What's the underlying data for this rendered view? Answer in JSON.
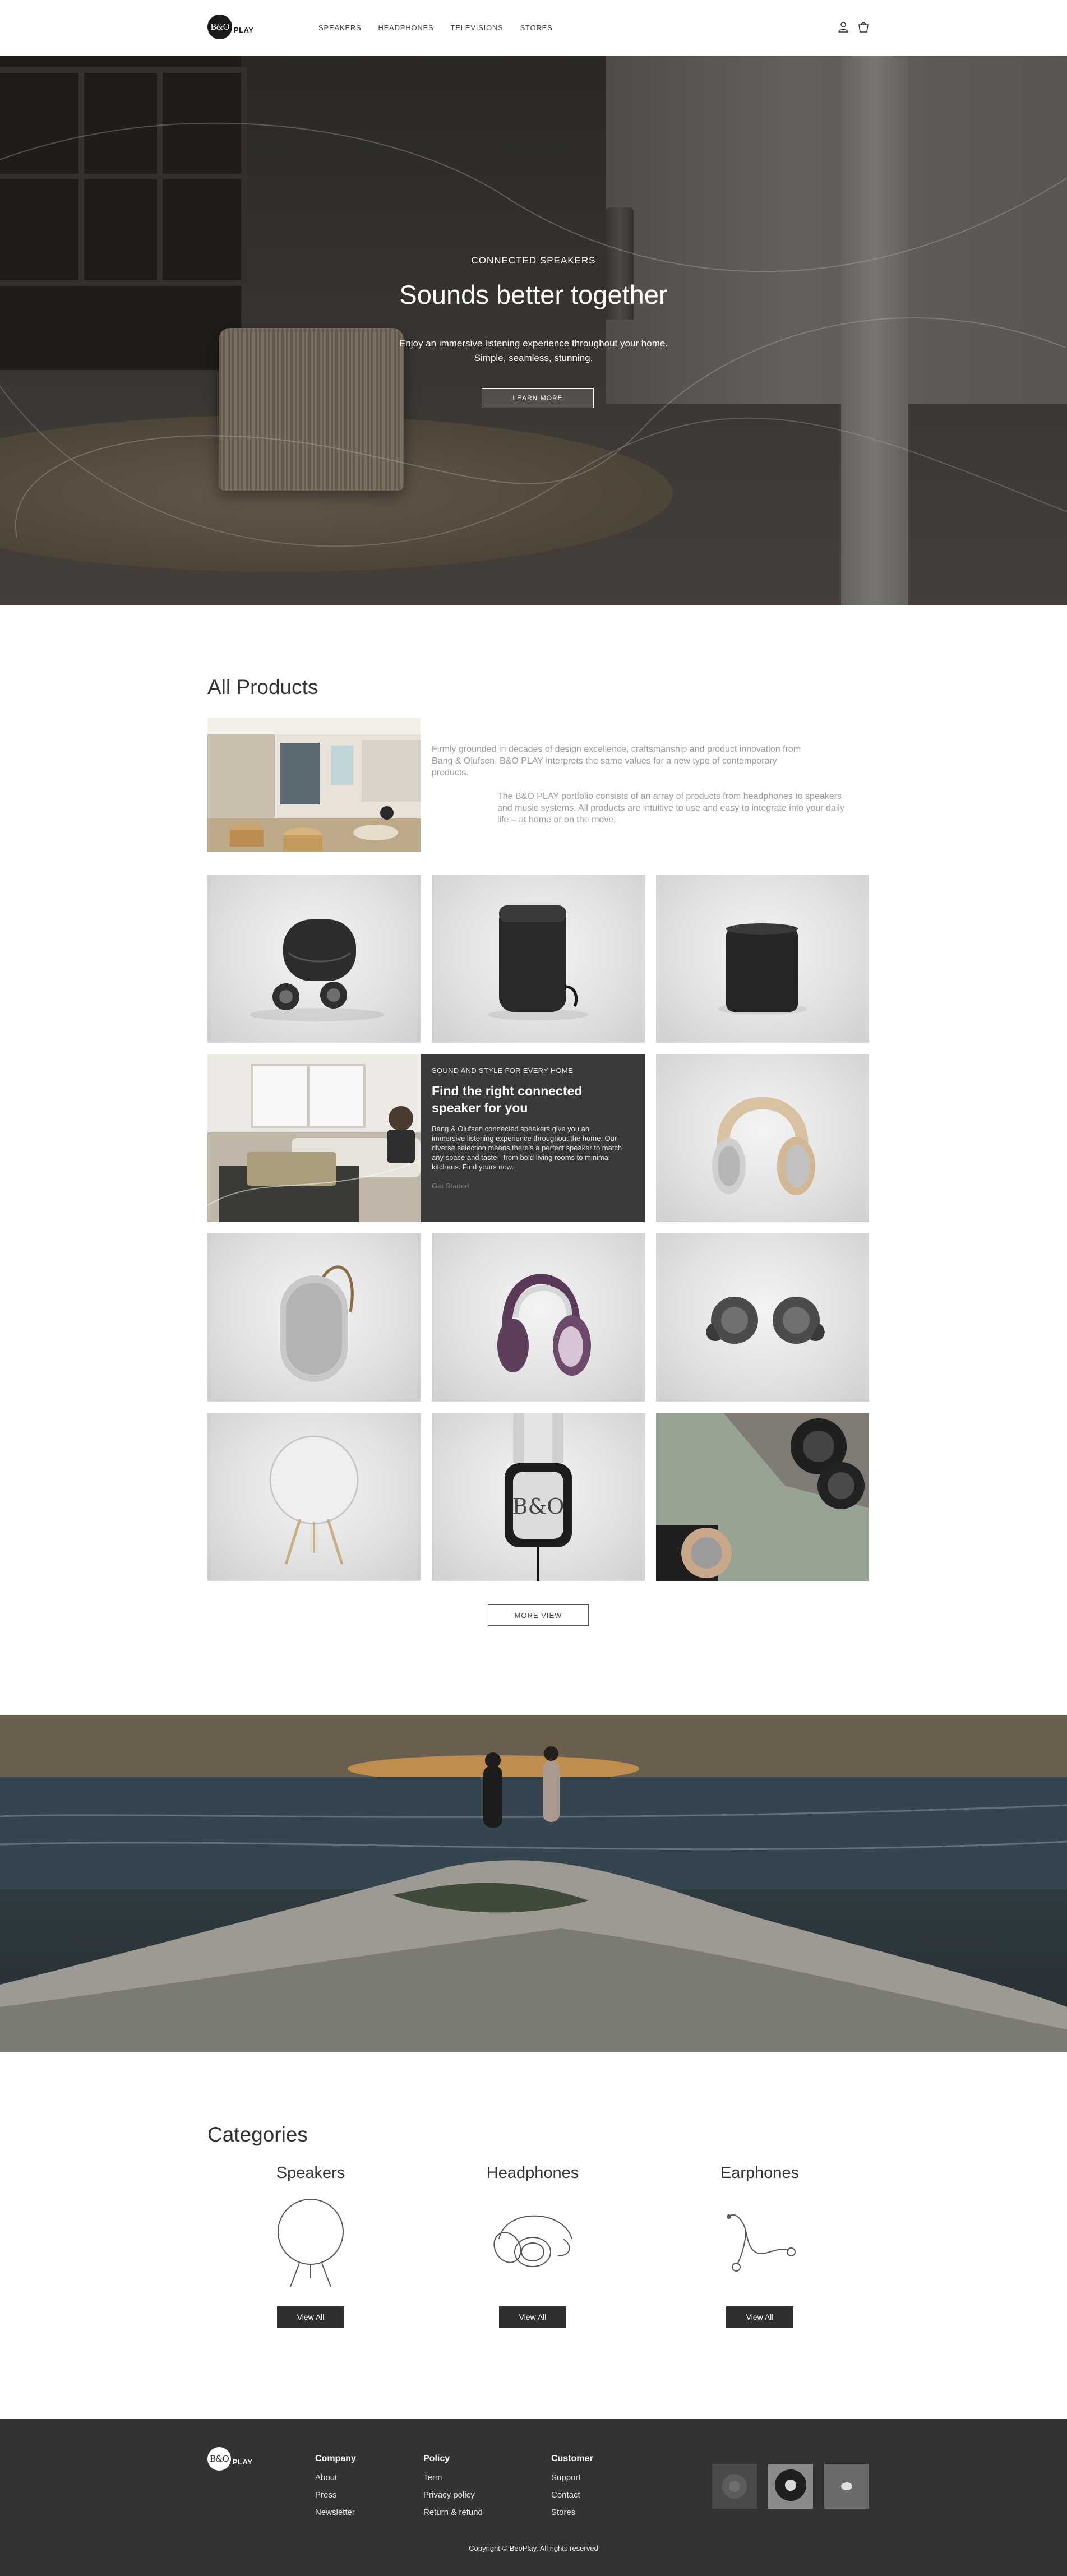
{
  "brand": {
    "logo_mark": "B&O",
    "logo_text": "PLAY"
  },
  "nav": {
    "items": [
      "SPEAKERS",
      "HEADPHONES",
      "TELEVISIONS",
      "STORES"
    ]
  },
  "header_icons": [
    "user-icon",
    "shopping-bag-icon"
  ],
  "hero": {
    "eyebrow": "CONNECTED SPEAKERS",
    "title": "Sounds better together",
    "subtitle_line1": "Enjoy an immersive listening experience throughout your home.",
    "subtitle_line2": "Simple, seamless, stunning.",
    "button": "LEARN MORE"
  },
  "all_products": {
    "title": "All Products",
    "intro_1": "Firmly grounded in decades of design excellence, craftsmanship and product innovation from Bang & Olufsen, B&O PLAY interprets the same values for a new type of contemporary products.",
    "intro_2": "The B&O PLAY portfolio consists of an array of products from headphones to speakers and music systems. All products are intuitive to use and easy to integrate into your daily life – at home or on the move.",
    "feature": {
      "eyebrow": "SOUND AND STYLE FOR EVERY HOME",
      "title": "Find the right connected speaker for you",
      "body": "Bang & Olufsen connected speakers give you an immersive listening experience throughout the home. Our diverse selection means there's a perfect speaker to match any space and taste - from bold living rooms to minimal kitchens. Find yours now.",
      "link": "Get Started"
    },
    "products": [
      "earphones-with-case",
      "portable-speaker-dark",
      "cylinder-speaker-dark",
      "living-room-scene",
      "headphones-beige",
      "portable-speaker-strap",
      "headphones-purple",
      "earphones-grey",
      "speaker-round-stand",
      "headphones-hanging",
      "headphones-lifestyle"
    ],
    "more_button": "MORE VIEW"
  },
  "categories": {
    "title": "Categories",
    "items": [
      {
        "name": "Speakers",
        "button": "View All"
      },
      {
        "name": "Headphones",
        "button": "View All"
      },
      {
        "name": "Earphones",
        "button": "View All"
      }
    ]
  },
  "footer": {
    "columns": [
      {
        "title": "Company",
        "links": [
          "About",
          "Press",
          "Newsletter"
        ]
      },
      {
        "title": "Policy",
        "links": [
          "Term",
          "Privacy policy",
          "Return & refund"
        ]
      },
      {
        "title": "Customer",
        "links": [
          "Support",
          "Contact",
          "Stores"
        ]
      }
    ],
    "copyright": "Copyright © BeoPlay. All rights reserved"
  }
}
